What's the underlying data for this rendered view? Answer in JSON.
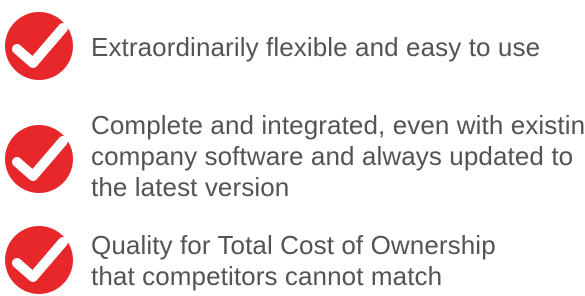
{
  "colors": {
    "badge_red": "#e8272b",
    "check_white": "#ffffff",
    "text_gray": "#545454",
    "background": "#ffffff"
  },
  "features": [
    {
      "icon": "red-check-icon",
      "lines": [
        "Extraordinarily flexible and easy to use"
      ]
    },
    {
      "icon": "red-check-icon",
      "lines": [
        "Complete and integrated, even with existing",
        "company software and always updated to",
        "the latest version"
      ]
    },
    {
      "icon": "red-check-icon",
      "lines": [
        "Quality for Total Cost of Ownership",
        "that competitors cannot match"
      ]
    }
  ]
}
